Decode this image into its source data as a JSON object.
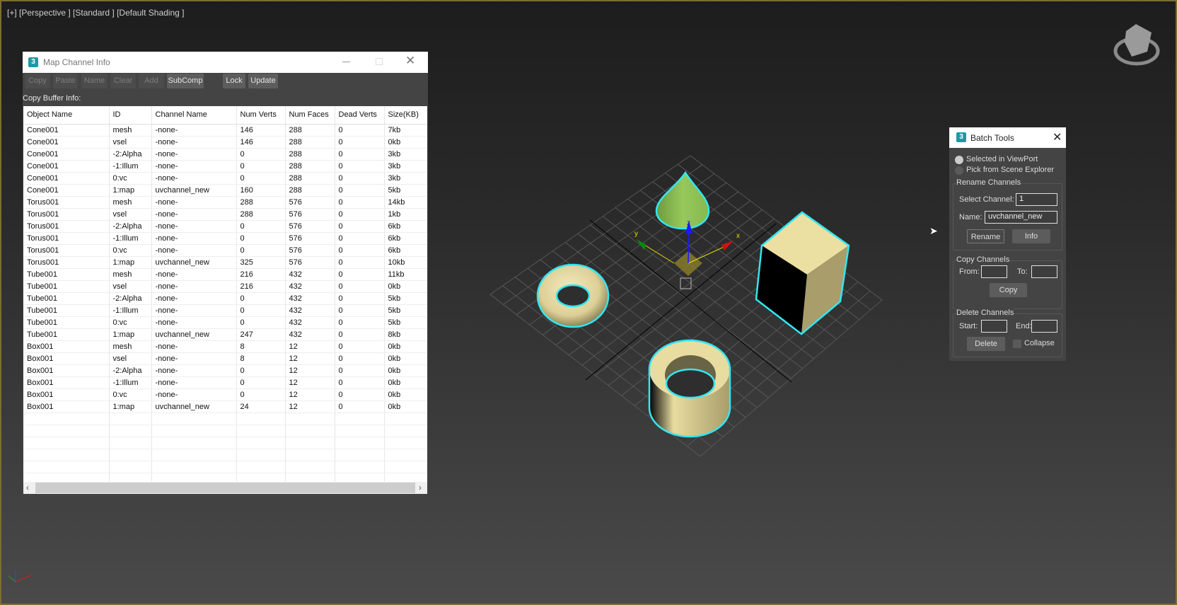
{
  "viewport": {
    "label": "[+] [Perspective ] [Standard ] [Default Shading ]",
    "gizmo_axes": [
      "x",
      "y",
      "z"
    ]
  },
  "colors": {
    "selection": "#33e6f0",
    "cone": "#8cbf55",
    "object": "#e8dca0",
    "accent": "#1b9aa5"
  },
  "map_channel_info": {
    "title": "Map Channel Info",
    "app_icon": "3",
    "toolbar": {
      "copy": "Copy",
      "paste": "Paste",
      "name": "Name",
      "clear": "Clear",
      "add": "Add",
      "subcomp": "SubComp",
      "lock": "Lock",
      "update": "Update"
    },
    "copy_buffer_label": "Copy Buffer Info:",
    "columns": [
      "Object Name",
      "ID",
      "Channel Name",
      "Num Verts",
      "Num Faces",
      "Dead Verts",
      "Size(KB)"
    ],
    "rows": [
      [
        "Cone001",
        "mesh",
        "-none-",
        "146",
        "288",
        "0",
        "7kb"
      ],
      [
        "Cone001",
        "vsel",
        "-none-",
        "146",
        "288",
        "0",
        "0kb"
      ],
      [
        "Cone001",
        "-2:Alpha",
        "-none-",
        "0",
        "288",
        "0",
        "3kb"
      ],
      [
        "Cone001",
        "-1:Illum",
        "-none-",
        "0",
        "288",
        "0",
        "3kb"
      ],
      [
        "Cone001",
        "0:vc",
        "-none-",
        "0",
        "288",
        "0",
        "3kb"
      ],
      [
        "Cone001",
        "1:map",
        "uvchannel_new",
        "160",
        "288",
        "0",
        "5kb"
      ],
      [
        "Torus001",
        "mesh",
        "-none-",
        "288",
        "576",
        "0",
        "14kb"
      ],
      [
        "Torus001",
        "vsel",
        "-none-",
        "288",
        "576",
        "0",
        "1kb"
      ],
      [
        "Torus001",
        "-2:Alpha",
        "-none-",
        "0",
        "576",
        "0",
        "6kb"
      ],
      [
        "Torus001",
        "-1:Illum",
        "-none-",
        "0",
        "576",
        "0",
        "6kb"
      ],
      [
        "Torus001",
        "0:vc",
        "-none-",
        "0",
        "576",
        "0",
        "6kb"
      ],
      [
        "Torus001",
        "1:map",
        "uvchannel_new",
        "325",
        "576",
        "0",
        "10kb"
      ],
      [
        "Tube001",
        "mesh",
        "-none-",
        "216",
        "432",
        "0",
        "11kb"
      ],
      [
        "Tube001",
        "vsel",
        "-none-",
        "216",
        "432",
        "0",
        "0kb"
      ],
      [
        "Tube001",
        "-2:Alpha",
        "-none-",
        "0",
        "432",
        "0",
        "5kb"
      ],
      [
        "Tube001",
        "-1:Illum",
        "-none-",
        "0",
        "432",
        "0",
        "5kb"
      ],
      [
        "Tube001",
        "0:vc",
        "-none-",
        "0",
        "432",
        "0",
        "5kb"
      ],
      [
        "Tube001",
        "1:map",
        "uvchannel_new",
        "247",
        "432",
        "0",
        "8kb"
      ],
      [
        "Box001",
        "mesh",
        "-none-",
        "8",
        "12",
        "0",
        "0kb"
      ],
      [
        "Box001",
        "vsel",
        "-none-",
        "8",
        "12",
        "0",
        "0kb"
      ],
      [
        "Box001",
        "-2:Alpha",
        "-none-",
        "0",
        "12",
        "0",
        "0kb"
      ],
      [
        "Box001",
        "-1:Illum",
        "-none-",
        "0",
        "12",
        "0",
        "0kb"
      ],
      [
        "Box001",
        "0:vc",
        "-none-",
        "0",
        "12",
        "0",
        "0kb"
      ],
      [
        "Box001",
        "1:map",
        "uvchannel_new",
        "24",
        "12",
        "0",
        "0kb"
      ]
    ]
  },
  "batch_tools": {
    "title": "Batch Tools",
    "app_icon": "3",
    "radio_selected": "Selected in ViewPort",
    "radio_pick": "Pick from Scene Explorer",
    "rename_group": "Rename Channels",
    "select_channel_label": "Select Channel:",
    "select_channel_value": "1",
    "name_label": "Name:",
    "name_value": "uvchannel_new",
    "rename_btn": "Rename",
    "info_btn": "Info",
    "copy_group": "Copy Channels",
    "from_label": "From:",
    "to_label": "To:",
    "copy_btn": "Copy",
    "delete_group": "Delete Channels",
    "start_label": "Start:",
    "end_label": "End:",
    "delete_btn": "Delete",
    "collapse_label": "Collapse"
  }
}
